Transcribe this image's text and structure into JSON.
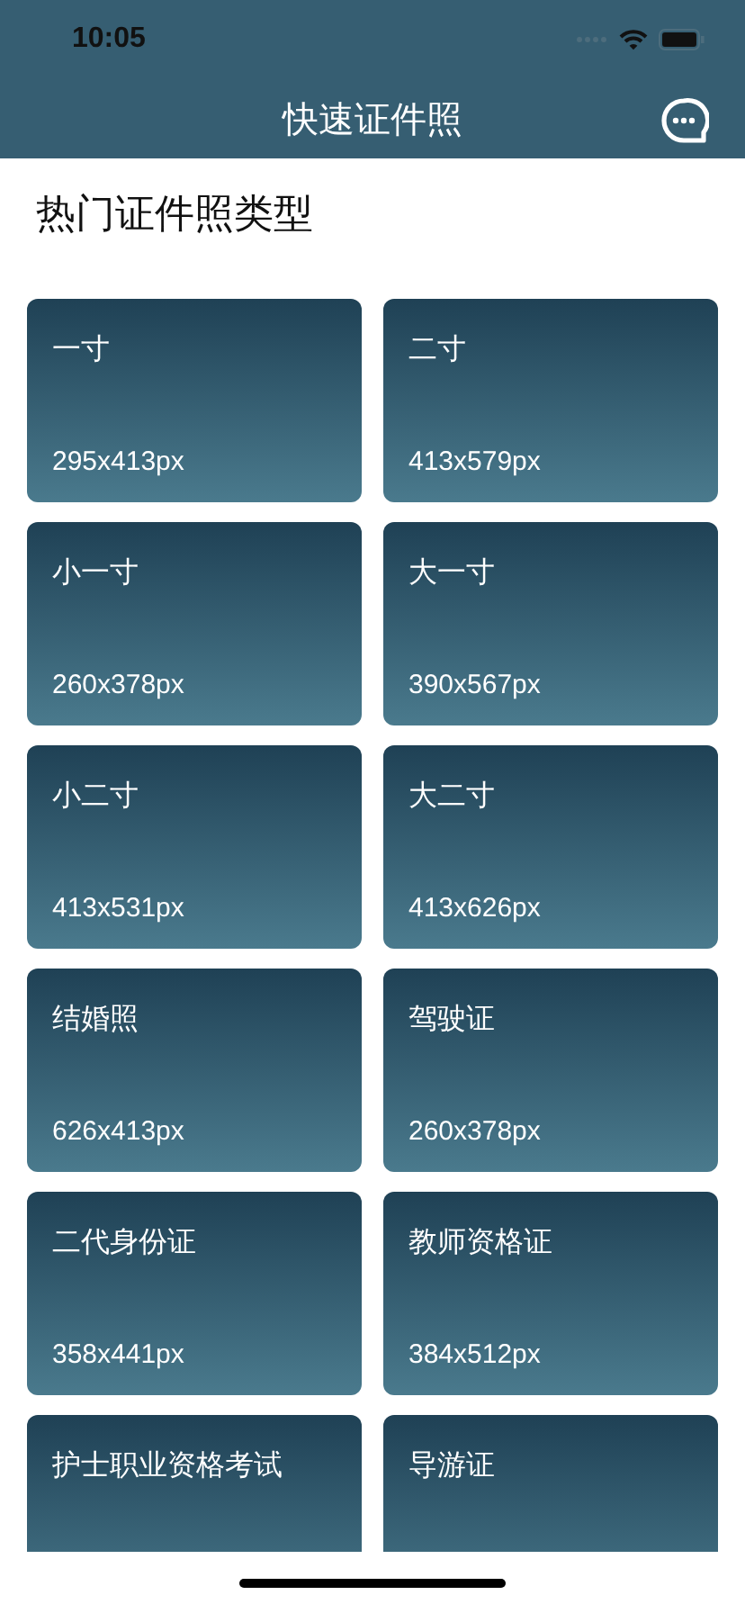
{
  "status_bar": {
    "time": "10:05"
  },
  "nav": {
    "title": "快速证件照"
  },
  "section": {
    "title": "热门证件照类型"
  },
  "types": [
    {
      "name": "一寸",
      "size": "295x413px"
    },
    {
      "name": "二寸",
      "size": "413x579px"
    },
    {
      "name": "小一寸",
      "size": "260x378px"
    },
    {
      "name": "大一寸",
      "size": "390x567px"
    },
    {
      "name": "小二寸",
      "size": "413x531px"
    },
    {
      "name": "大二寸",
      "size": "413x626px"
    },
    {
      "name": "结婚照",
      "size": "626x413px"
    },
    {
      "name": "驾驶证",
      "size": "260x378px"
    },
    {
      "name": "二代身份证",
      "size": "358x441px"
    },
    {
      "name": "教师资格证",
      "size": "384x512px"
    },
    {
      "name": "护士职业资格考试"
    },
    {
      "name": "导游证"
    }
  ]
}
